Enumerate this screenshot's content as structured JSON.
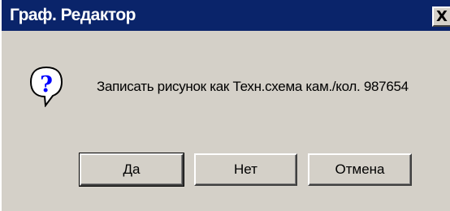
{
  "window": {
    "title": "Граф. Редактор",
    "close_glyph": "X"
  },
  "dialog": {
    "icon": "question-icon",
    "message": "Записать рисунок как Техн.схема кам./кол.  987654"
  },
  "buttons": {
    "yes_label": "Да",
    "no_label": "Нет",
    "cancel_label": "Отмена"
  },
  "colors": {
    "titlebar": "#0a246a",
    "face": "#d4d0c8",
    "icon_blue": "#0000ff"
  }
}
